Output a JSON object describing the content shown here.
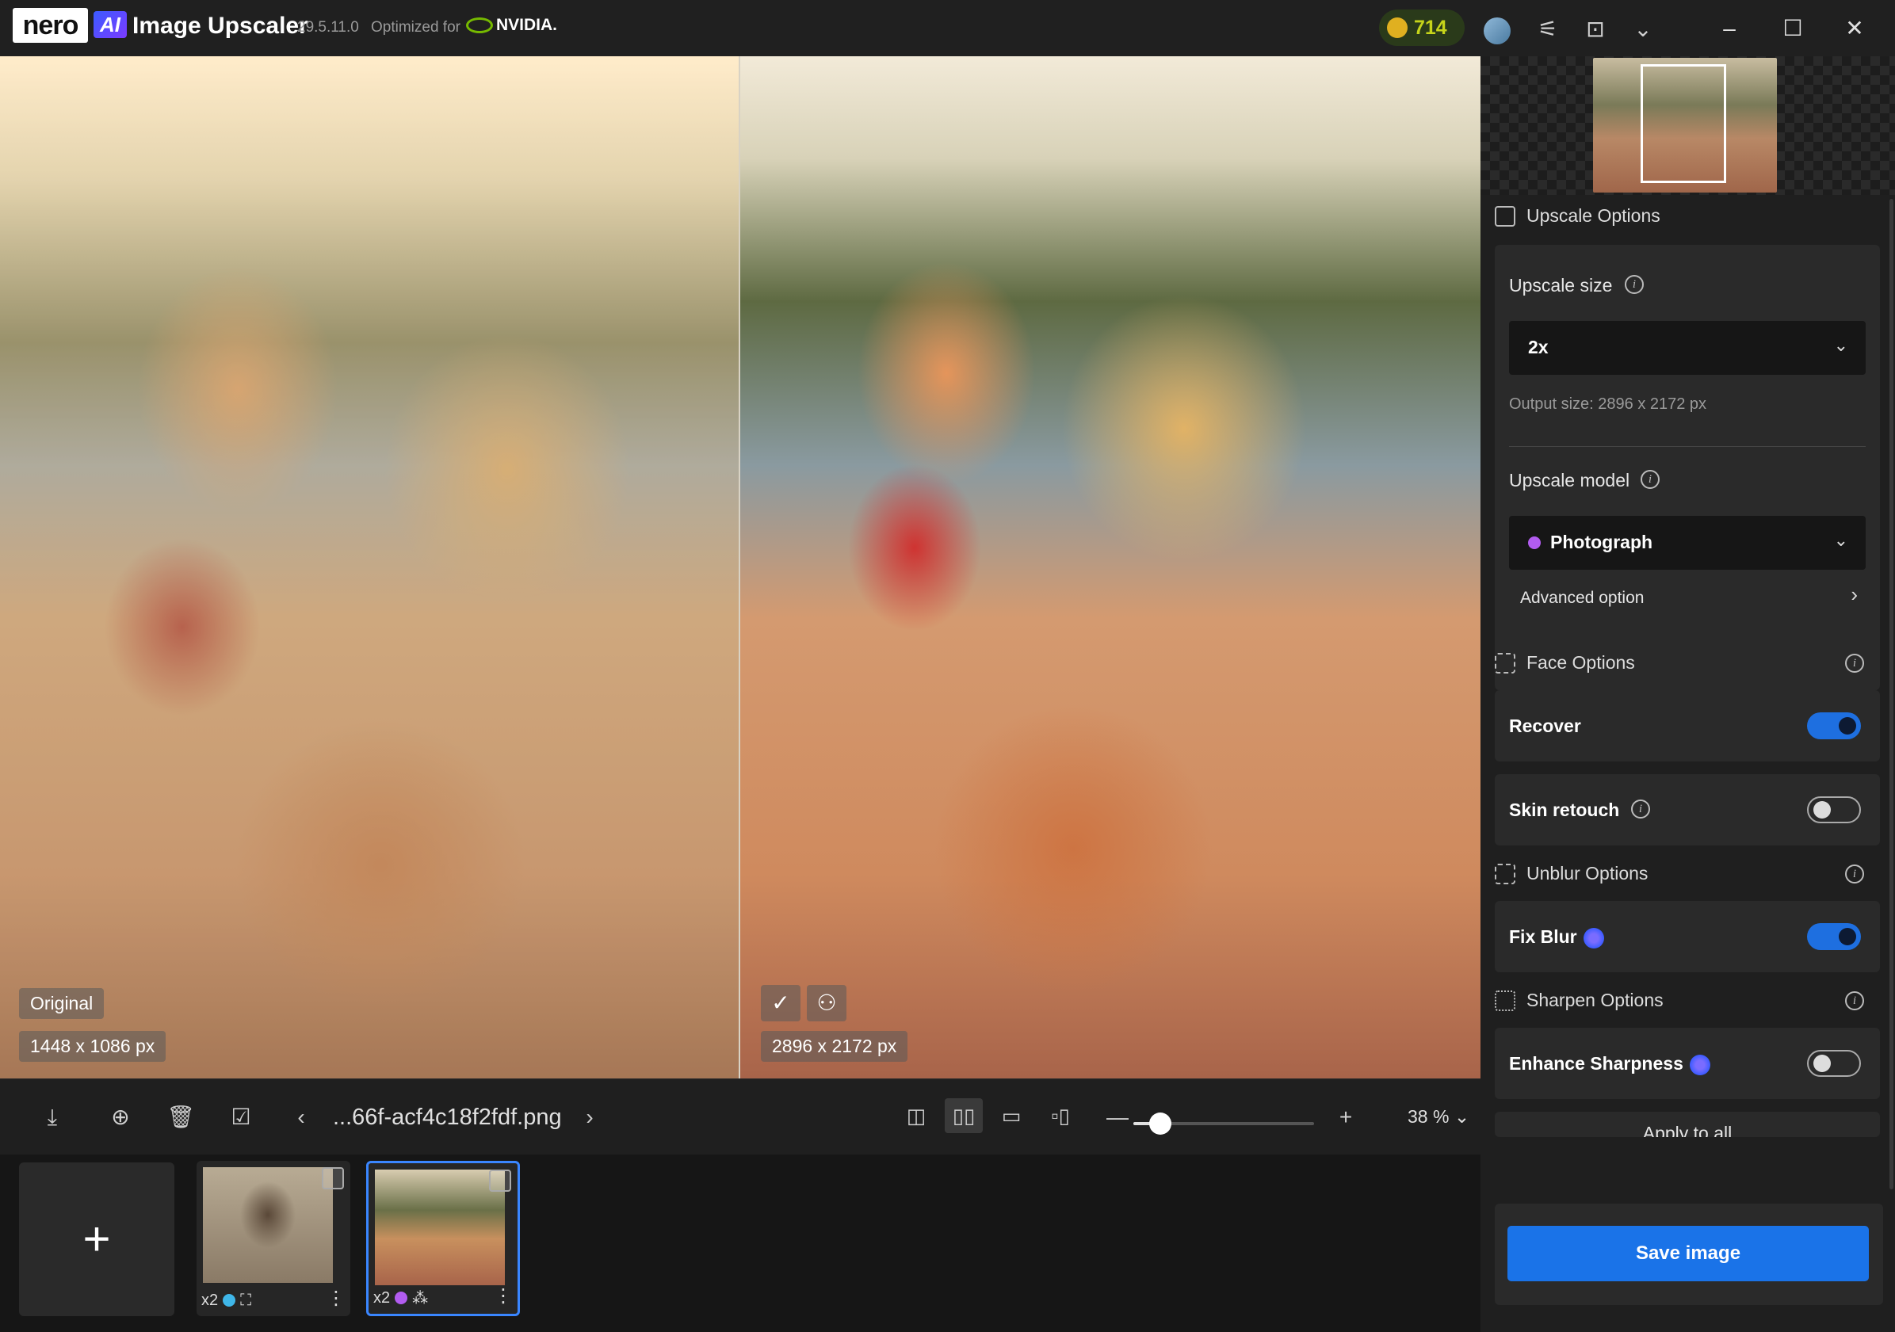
{
  "titlebar": {
    "brand": "nero",
    "ai_badge": "AI",
    "app_name": "Image Upscaler",
    "version": "29.5.11.0",
    "optimized_for": "Optimized for",
    "gpu_brand": "NVIDIA.",
    "credits": "714",
    "icons": [
      "coin-icon",
      "avatar-icon",
      "settings-sliders-icon",
      "gift-basket-icon",
      "chevron-down-icon",
      "minimize-icon",
      "maximize-icon",
      "close-icon"
    ]
  },
  "viewer": {
    "left_label": "Original",
    "left_size": "1448 x 1086 px",
    "right_size": "2896 x 2172 px"
  },
  "toolbar": {
    "filename": "...66f-acf4c18f2fdf.png",
    "zoom": "38 %",
    "zoom_fraction": 0.15
  },
  "filmstrip": {
    "add_label": "+",
    "items": [
      {
        "scale": "x2",
        "dot_color": "#3fb6e8"
      },
      {
        "scale": "x2",
        "dot_color": "#b25cf0"
      }
    ]
  },
  "panel": {
    "upscale_options": "Upscale Options",
    "upscale_size_label": "Upscale size",
    "upscale_size_value": "2x",
    "output_size": "Output size: 2896 x 2172 px",
    "upscale_model_label": "Upscale model",
    "upscale_model_value": "Photograph",
    "model_dot_color": "#b25cf0",
    "advanced_option": "Advanced option",
    "face_options": "Face Options",
    "recover_label": "Recover",
    "recover_on": true,
    "skin_retouch_label": "Skin retouch",
    "skin_retouch_on": false,
    "unblur_options": "Unblur Options",
    "fix_blur_label": "Fix Blur",
    "fix_blur_on": true,
    "sharpen_options": "Sharpen Options",
    "enhance_sharpness_label": "Enhance Sharpness",
    "enhance_sharpness_on": false,
    "apply_to_all": "Apply to all",
    "save_image": "Save image"
  },
  "colors": {
    "accent": "#1a73e8",
    "credits_text": "#c6d41a"
  }
}
